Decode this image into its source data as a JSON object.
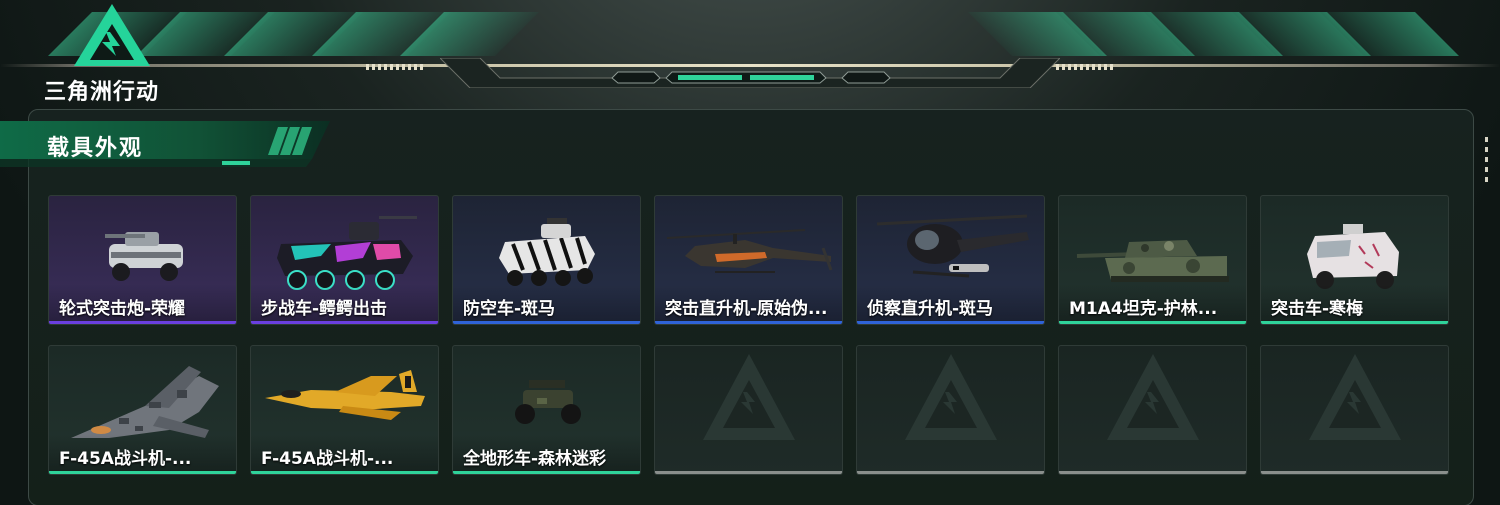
{
  "header": {
    "logo_text": "三角洲行动"
  },
  "section": {
    "title": "载具外观"
  },
  "colors": {
    "purple": "#6a3fe0",
    "blue": "#2f63d8",
    "green": "#2fd39a",
    "empty": "#8a8f8c"
  },
  "items": [
    {
      "name": "轮式突击炮-荣耀",
      "rarity": "purple",
      "icon": "armored-car-icon"
    },
    {
      "name": "步战车-鳄鳄出击",
      "rarity": "purple",
      "icon": "ifv-graffiti-icon"
    },
    {
      "name": "防空车-斑马",
      "rarity": "blue",
      "icon": "aa-vehicle-zebra-icon"
    },
    {
      "name": "突击直升机-原始伪...",
      "rarity": "blue",
      "icon": "attack-helicopter-icon"
    },
    {
      "name": "侦察直升机-斑马",
      "rarity": "blue",
      "icon": "scout-helicopter-icon"
    },
    {
      "name": "M1A4坦克-护林...",
      "rarity": "green",
      "icon": "tank-icon"
    },
    {
      "name": "突击车-寒梅",
      "rarity": "green",
      "icon": "assault-vehicle-icon"
    },
    {
      "name": "F-45A战斗机-...",
      "rarity": "green",
      "icon": "fighter-jet-camo-icon"
    },
    {
      "name": "F-45A战斗机-...",
      "rarity": "green",
      "icon": "fighter-jet-yellow-icon"
    },
    {
      "name": "全地形车-森林迷彩",
      "rarity": "green",
      "icon": "atv-icon"
    },
    {
      "name": "",
      "rarity": "empty",
      "icon": "empty-slot-logo-icon"
    },
    {
      "name": "",
      "rarity": "empty",
      "icon": "empty-slot-logo-icon"
    },
    {
      "name": "",
      "rarity": "empty",
      "icon": "empty-slot-logo-icon"
    },
    {
      "name": "",
      "rarity": "empty",
      "icon": "empty-slot-logo-icon"
    }
  ]
}
